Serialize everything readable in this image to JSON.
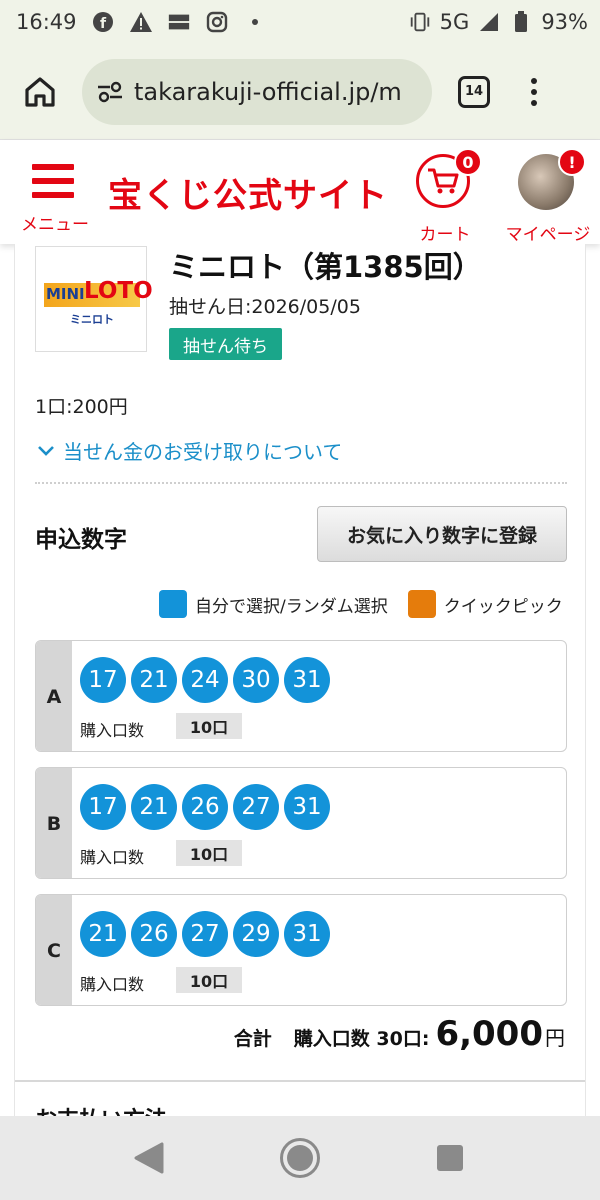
{
  "status_bar": {
    "time": "16:49",
    "network": "5G",
    "battery": "93%"
  },
  "browser": {
    "url": "takarakuji-official.jp/m",
    "tab_count": "14"
  },
  "site_header": {
    "menu_label": "メニュー",
    "logo": "宝くじ公式サイト",
    "cart_label": "カート",
    "cart_badge": "0",
    "mypage_label": "マイページ",
    "mypage_badge": "!"
  },
  "lottery": {
    "logo_mini": "MINI",
    "logo_loto": "LOTO",
    "logo_sub": "ミニロト",
    "title": "ミニロト（第1385回）",
    "draw_date": "抽せん日:2026/05/05",
    "status": "抽せん待ち",
    "price": "1口:200円",
    "prize_link": "当せん金のお受け取りについて"
  },
  "numbers_section": {
    "title": "申込数字",
    "favorite_button": "お気に入り数字に登録",
    "legend": [
      {
        "label": "自分で選択/ランダム選択",
        "color": "#1393d9"
      },
      {
        "label": "クイックピック",
        "color": "#e57c0c"
      }
    ],
    "qty_label": "購入口数",
    "lines": [
      {
        "letter": "A",
        "numbers": [
          "17",
          "21",
          "24",
          "30",
          "31"
        ],
        "qty": "10口"
      },
      {
        "letter": "B",
        "numbers": [
          "17",
          "21",
          "26",
          "27",
          "31"
        ],
        "qty": "10口"
      },
      {
        "letter": "C",
        "numbers": [
          "21",
          "26",
          "27",
          "29",
          "31"
        ],
        "qty": "10口"
      }
    ]
  },
  "total": {
    "label": "合計",
    "count": "購入口数 30口:",
    "amount": "6,000",
    "unit": "円"
  },
  "next_section": {
    "title": "お支払い方法"
  },
  "colors": {
    "brand_red": "#e30613",
    "ball_blue": "#1393d9",
    "status_green": "#1aa68a"
  }
}
